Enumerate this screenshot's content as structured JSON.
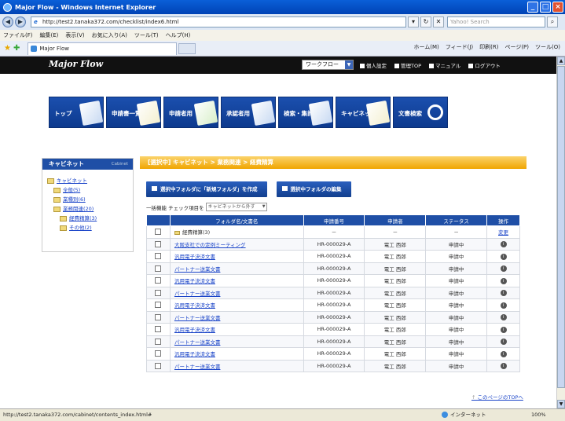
{
  "window": {
    "title": "Major Flow - Windows Internet Explorer"
  },
  "browser": {
    "url": "http://test2.tanaka372.com/checklist/index6.html",
    "search_placeholder": "Yahoo! Search",
    "menu": [
      "ファイル(F)",
      "編集(E)",
      "表示(V)",
      "お気に入り(A)",
      "ツール(T)",
      "ヘルプ(H)"
    ],
    "tab_title": "Major Flow",
    "tools": [
      "ホーム(M)",
      "フィード(J)",
      "印刷(R)",
      "ページ(P)",
      "ツール(O)"
    ]
  },
  "site": {
    "logo": "Major Flow",
    "workflow_select": "ワークフロー",
    "header_links": [
      "個人設定",
      "管理TOP",
      "マニュアル",
      "ログアウト"
    ]
  },
  "nav": [
    "トップ",
    "申請書一覧",
    "申請者用",
    "承認者用",
    "検索・集計",
    "キャビネット",
    "文書検索"
  ],
  "sidebar": {
    "title": "キャビネット",
    "subtitle": "Cabinet",
    "tree": [
      {
        "label": "キャビネット",
        "level": 0
      },
      {
        "label": "全般(5)",
        "level": 1
      },
      {
        "label": "業種別(6)",
        "level": 1
      },
      {
        "label": "業務関連(20)",
        "level": 1
      },
      {
        "label": "経費精算(3)",
        "level": 2
      },
      {
        "label": "その他(2)",
        "level": 2
      }
    ]
  },
  "main": {
    "breadcrumb": "[選択中] キャビネット > 業務関連 > 経費精算",
    "btn_create": "選択中フォルダに「新規フォルダ」を作成",
    "btn_edit": "選択中フォルダの編集",
    "bulk_label": "一括機能 チェック項目を",
    "bulk_select": "キャビネットから外す",
    "table": {
      "headers": [
        "",
        "フォルダ名/文書名",
        "申請番号",
        "申請者",
        "ステータス",
        "操作"
      ],
      "folder_row": {
        "name": "経費精算(3)",
        "number": "－",
        "applicant": "－",
        "status": "－",
        "op": "変更"
      },
      "rows": [
        {
          "name": "大阪支社での定例ミーティング",
          "number": "HR-000029-A",
          "applicant": "電工 西郎",
          "status": "申請中"
        },
        {
          "name": "汎用電子決済文書",
          "number": "HR-000029-A",
          "applicant": "電工 西郎",
          "status": "申請中"
        },
        {
          "name": "パートナー送業文書",
          "number": "HR-000029-A",
          "applicant": "電工 西郎",
          "status": "申請中"
        },
        {
          "name": "汎用電子決済文書",
          "number": "HR-000029-A",
          "applicant": "電工 西郎",
          "status": "申請中"
        },
        {
          "name": "パートナー送業文書",
          "number": "HR-000029-A",
          "applicant": "電工 西郎",
          "status": "申請中"
        },
        {
          "name": "汎用電子決済文書",
          "number": "HR-000029-A",
          "applicant": "電工 西郎",
          "status": "申請中"
        },
        {
          "name": "パートナー送業文書",
          "number": "HR-000029-A",
          "applicant": "電工 西郎",
          "status": "申請中"
        },
        {
          "name": "汎用電子決済文書",
          "number": "HR-000029-A",
          "applicant": "電工 西郎",
          "status": "申請中"
        },
        {
          "name": "パートナー送業文書",
          "number": "HR-000029-A",
          "applicant": "電工 西郎",
          "status": "申請中"
        },
        {
          "name": "汎用電子決済文書",
          "number": "HR-000029-A",
          "applicant": "電工 西郎",
          "status": "申請中"
        },
        {
          "name": "パートナー送業文書",
          "number": "HR-000029-A",
          "applicant": "電工 西郎",
          "status": "申請中"
        }
      ]
    },
    "to_top": "このページのTOPへ"
  },
  "statusbar": {
    "url": "http://test2.tanaka372.com/cabinet/contents_index.html#",
    "zone": "インターネット",
    "zoom": "100%"
  },
  "colors": {
    "brand_blue": "#1f4fa6",
    "accent_orange": "#f0a500",
    "link": "#1a44c8"
  }
}
